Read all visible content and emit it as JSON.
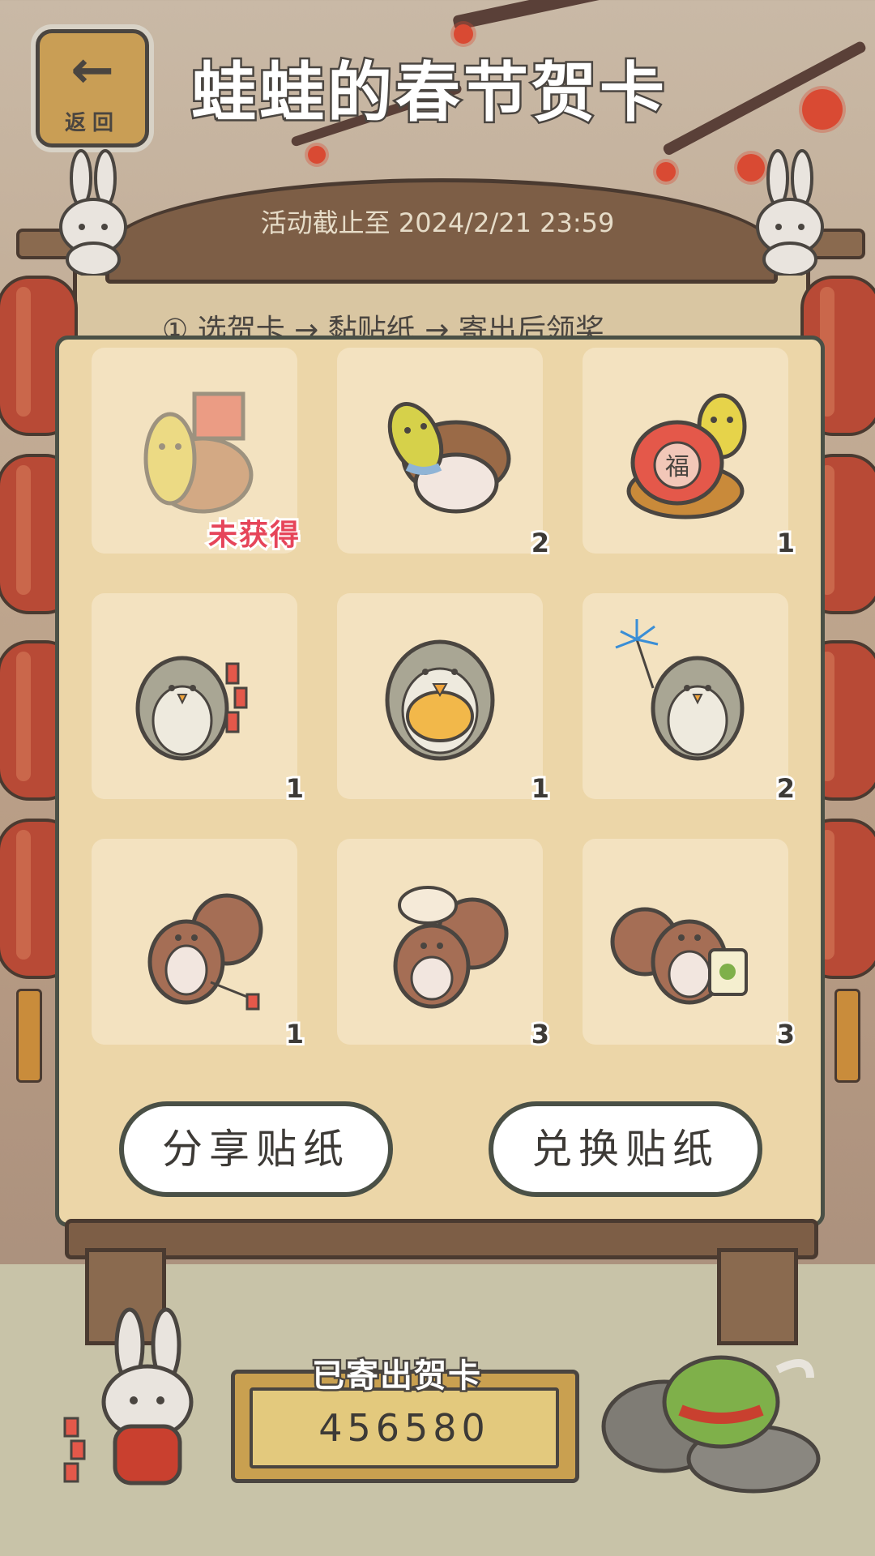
{
  "header": {
    "back_icon": "arrow-left-icon",
    "back_label": "返回",
    "title": "蛙蛙的春节贺卡"
  },
  "board": {
    "deadline": "活动截止至 2024/2/21 23:59",
    "steps": "① 选贺卡 → 黏贴纸 → 寄出后领奖"
  },
  "stickers": [
    {
      "name": "frog-turtle-envelopes",
      "count": "",
      "status": "未获得",
      "obtained": false
    },
    {
      "name": "frog-turtle-sleeping",
      "count": "2",
      "status": "",
      "obtained": true
    },
    {
      "name": "frog-fortune-bag",
      "count": "1",
      "status": "",
      "obtained": true
    },
    {
      "name": "owl-firecrackers",
      "count": "1",
      "status": "",
      "obtained": true
    },
    {
      "name": "owl-holding-duck",
      "count": "1",
      "status": "",
      "obtained": true
    },
    {
      "name": "owl-sparkler",
      "count": "2",
      "status": "",
      "obtained": true
    },
    {
      "name": "squirrel-firecracker",
      "count": "1",
      "status": "",
      "obtained": true
    },
    {
      "name": "squirrel-dumpling-hat",
      "count": "3",
      "status": "",
      "obtained": true
    },
    {
      "name": "squirrel-clover-bag",
      "count": "3",
      "status": "",
      "obtained": true
    }
  ],
  "buttons": {
    "share": "分享贴纸",
    "exchange": "兑换贴纸"
  },
  "footer": {
    "sent_label": "已寄出贺卡",
    "sent_count": "456580"
  },
  "colors": {
    "accent_red": "#e6455a",
    "panel": "#ecd6a8",
    "card": "#f3e2c0",
    "wood": "#7d5e46"
  }
}
